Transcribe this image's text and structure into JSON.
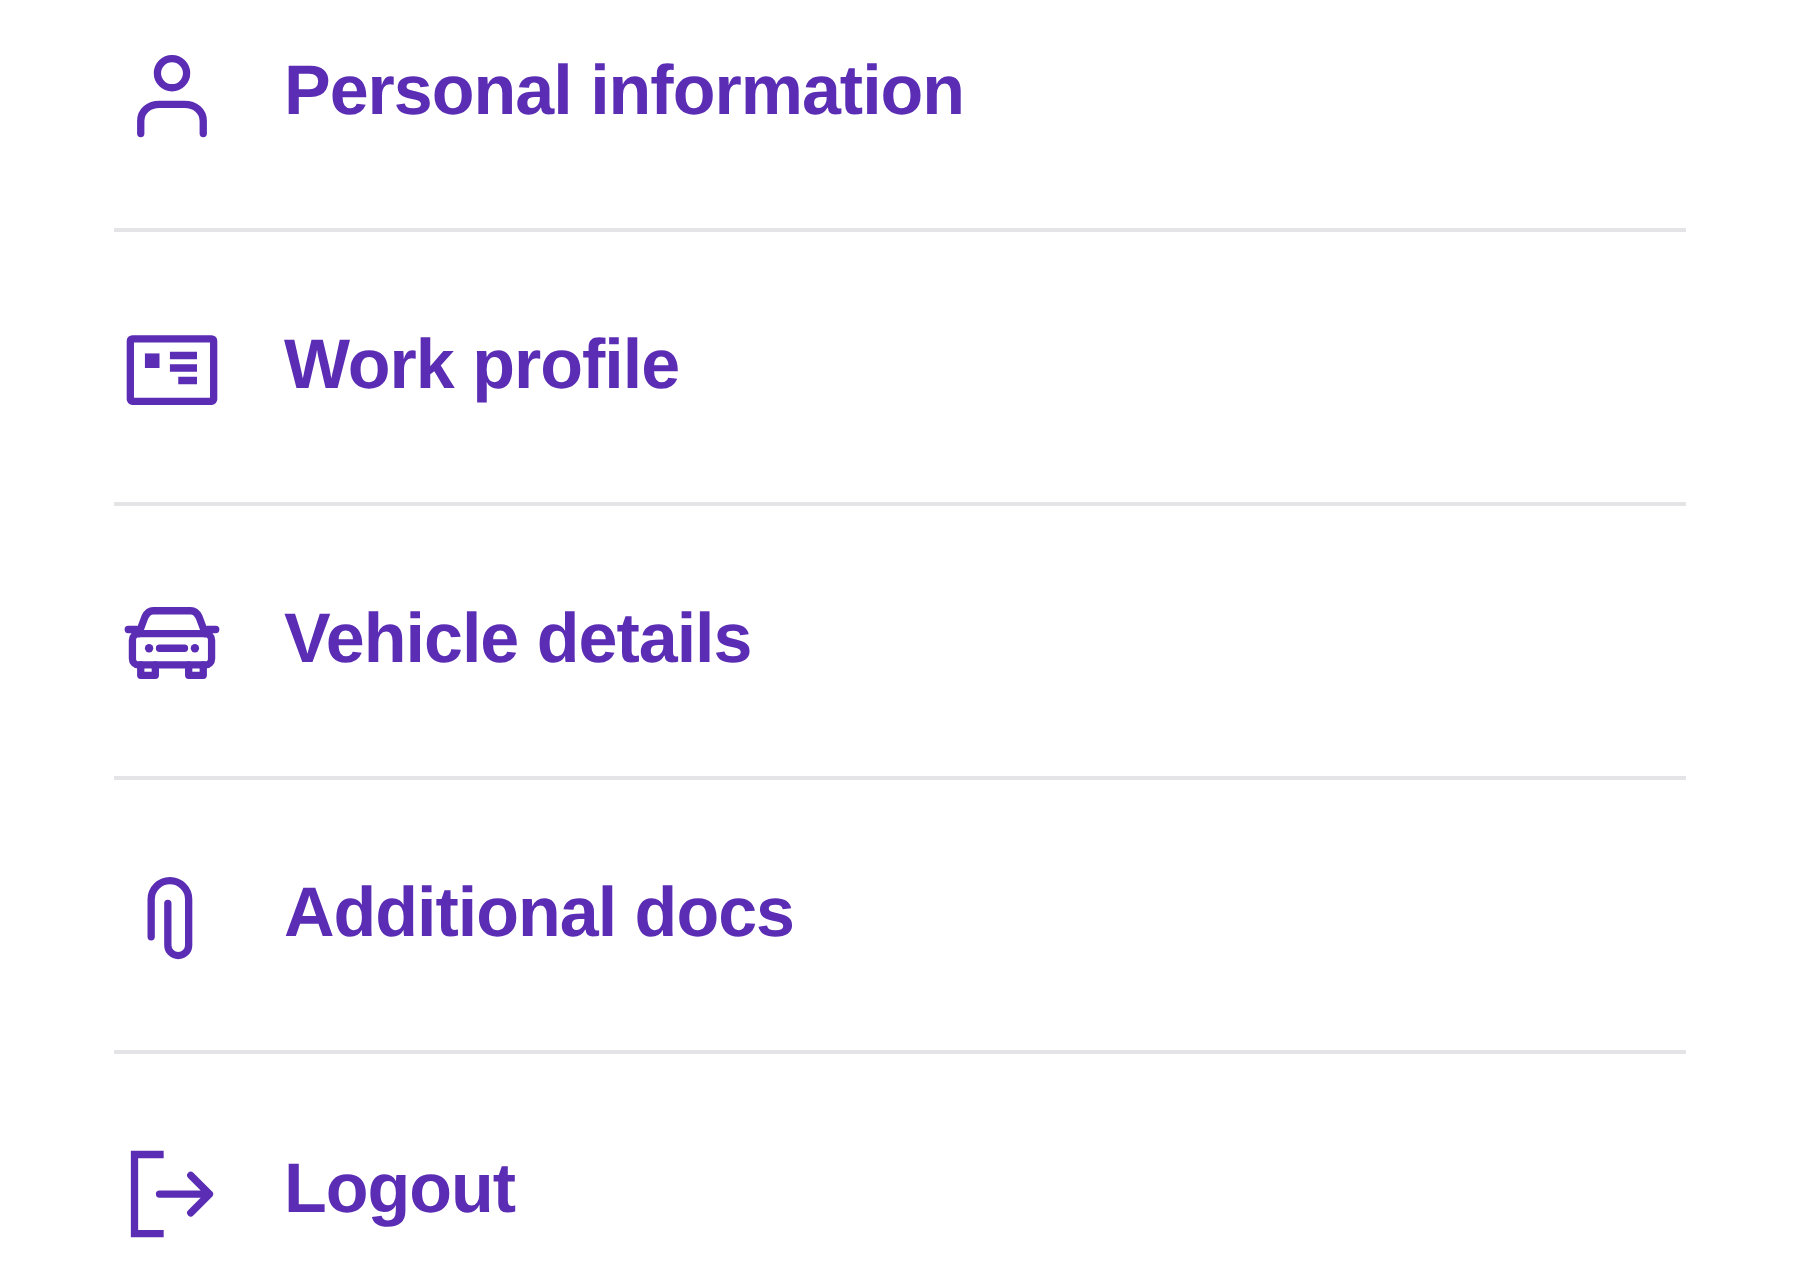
{
  "menu": [
    {
      "kind": "person",
      "label": "Personal information"
    },
    {
      "kind": "card",
      "label": "Work profile"
    },
    {
      "kind": "car",
      "label": "Vehicle details"
    },
    {
      "kind": "clip",
      "label": "Additional docs"
    },
    {
      "kind": "logout",
      "label": "Logout"
    }
  ]
}
